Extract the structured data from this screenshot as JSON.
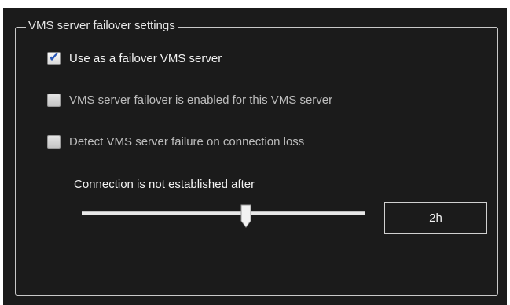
{
  "group": {
    "title": "VMS server failover settings"
  },
  "options": [
    {
      "label": "Use as a failover VMS server",
      "checked": true,
      "enabled": true
    },
    {
      "label": "VMS server failover is enabled for this VMS server",
      "checked": false,
      "enabled": false
    },
    {
      "label": "Detect VMS server failure on connection loss",
      "checked": false,
      "enabled": false
    }
  ],
  "connection": {
    "label": "Connection is not established after",
    "slider_fraction": 0.58,
    "value": "2h"
  },
  "colors": {
    "panel_bg": "#1b1b1b",
    "check_mark": "#2a59b8"
  }
}
